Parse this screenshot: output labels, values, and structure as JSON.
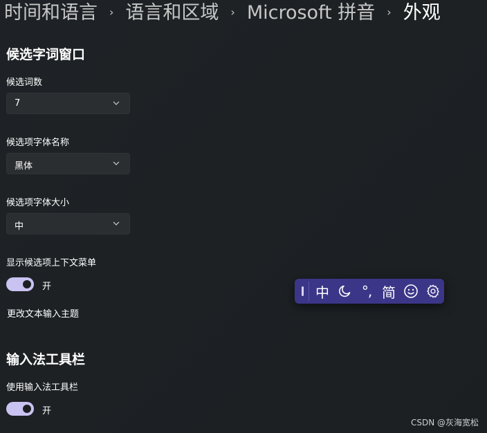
{
  "breadcrumb": {
    "items": [
      "时间和语言",
      "语言和区域",
      "Microsoft 拼音",
      "外观"
    ],
    "separator": "›"
  },
  "candidate_window": {
    "title": "候选字词窗口",
    "count": {
      "label": "候选词数",
      "value": "7"
    },
    "font_name": {
      "label": "候选项字体名称",
      "value": "黑体"
    },
    "font_size": {
      "label": "候选项字体大小",
      "value": "中"
    },
    "context_menu": {
      "label": "显示候选项上下文菜单",
      "state": "开",
      "on": true
    },
    "theme_link": "更改文本输入主题"
  },
  "ime_toolbar_section": {
    "title": "输入法工具栏",
    "use_toolbar": {
      "label": "使用输入法工具栏",
      "state": "开",
      "on": true
    }
  },
  "ime_toolbar": {
    "mode": "中",
    "half_full_icon": "moon-icon",
    "punctuation": "°,",
    "script": "简",
    "emoji_icon": "smiley-icon",
    "settings_icon": "gear-icon",
    "background": "#3c3688"
  },
  "colors": {
    "accent": "#c9c3f2"
  },
  "watermark": "CSDN @灰海宽松"
}
